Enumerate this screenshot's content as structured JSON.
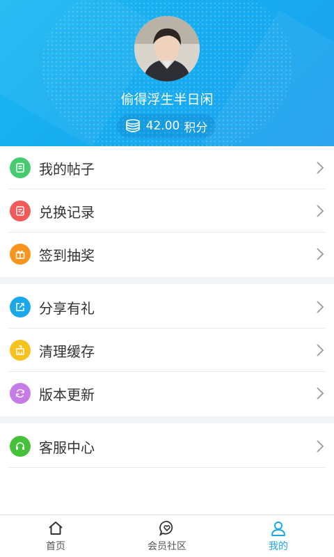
{
  "profile": {
    "username": "偷得浮生半日闲",
    "points_value": "42.00",
    "points_unit": "积分"
  },
  "menu": {
    "group1": [
      {
        "label": "我的帖子",
        "icon": "post-icon",
        "color": "#46cc6e"
      },
      {
        "label": "兑换记录",
        "icon": "record-icon",
        "color": "#f25a5a"
      },
      {
        "label": "签到抽奖",
        "icon": "gift-icon",
        "color": "#f7941e"
      }
    ],
    "group2": [
      {
        "label": "分享有礼",
        "icon": "share-icon",
        "color": "#1aa7ec"
      },
      {
        "label": "清理缓存",
        "icon": "broom-icon",
        "color": "#f7c21e"
      },
      {
        "label": "版本更新",
        "icon": "refresh-icon",
        "color": "#c77be6"
      }
    ],
    "group3": [
      {
        "label": "客服中心",
        "icon": "headset-icon",
        "color": "#46c23a"
      }
    ]
  },
  "tabbar": {
    "home": "首页",
    "community": "会员社区",
    "mine": "我的",
    "active_color": "#1aa7ec"
  }
}
